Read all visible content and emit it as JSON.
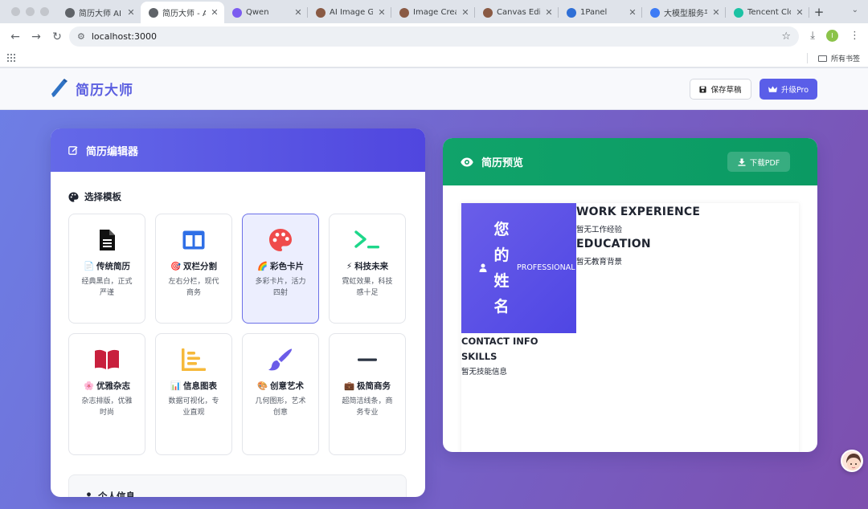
{
  "browser": {
    "tabs": [
      {
        "title": "简历大师 AI -",
        "active": false,
        "favicon": "globe-icon"
      },
      {
        "title": "简历大师 - AI",
        "active": true,
        "favicon": "globe-icon"
      },
      {
        "title": "Qwen",
        "active": false,
        "favicon": "qwen-icon"
      },
      {
        "title": "AI Image Gen",
        "active": false,
        "favicon": "image-icon"
      },
      {
        "title": "Image Creati",
        "active": false,
        "favicon": "image-icon"
      },
      {
        "title": "Canvas Edito",
        "active": false,
        "favicon": "image-icon"
      },
      {
        "title": "1Panel",
        "active": false,
        "favicon": "panel-icon"
      },
      {
        "title": "大模型服务平",
        "active": false,
        "favicon": "model-icon"
      },
      {
        "title": "Tencent Clou",
        "active": false,
        "favicon": "cloud-icon"
      }
    ],
    "url": "localhost:3000",
    "bookmarks_all": "所有书签",
    "profile_initial": "I"
  },
  "app": {
    "brand_name": "简历大师",
    "save_draft": "保存草稿",
    "upgrade_pro": "升级Pro"
  },
  "editor": {
    "title": "简历编辑器",
    "template_section": "选择模板",
    "templates": [
      {
        "emoji": "📄",
        "name": "传统简历",
        "desc": "经典黑白，正式严谨",
        "icon": "document-icon",
        "selected": false
      },
      {
        "emoji": "🎯",
        "name": "双栏分割",
        "desc": "左右分栏，现代商务",
        "icon": "columns-icon",
        "selected": false
      },
      {
        "emoji": "🌈",
        "name": "彩色卡片",
        "desc": "多彩卡片，活力四射",
        "icon": "palette-icon",
        "selected": true
      },
      {
        "emoji": "⚡",
        "name": "科技未来",
        "desc": "霓虹效果，科技感十足",
        "icon": "terminal-icon",
        "selected": false
      },
      {
        "emoji": "🌸",
        "name": "优雅杂志",
        "desc": "杂志排版，优雅时尚",
        "icon": "book-icon",
        "selected": false
      },
      {
        "emoji": "📊",
        "name": "信息图表",
        "desc": "数据可视化，专业直观",
        "icon": "chart-icon",
        "selected": false
      },
      {
        "emoji": "🎨",
        "name": "创意艺术",
        "desc": "几何图形，艺术创意",
        "icon": "brush-icon",
        "selected": false
      },
      {
        "emoji": "💼",
        "name": "极简商务",
        "desc": "超简洁线条，商务专业",
        "icon": "minus-icon",
        "selected": false
      }
    ],
    "personal_section": "个人信息"
  },
  "preview": {
    "title": "简历预览",
    "download_pdf": "下载PDF",
    "name_placeholder": "您的姓名",
    "professional": "PROFESSIONAL",
    "work_heading": "WORK EXPERIENCE",
    "work_empty": "暂无工作经验",
    "edu_heading": "EDUCATION",
    "edu_empty": "暂无教育背景",
    "contact_heading": "CONTACT INFO",
    "skills_heading": "SKILLS",
    "skills_empty": "暂无技能信息"
  },
  "colors": {
    "accent": "#5a5ee8",
    "preview_header": "#10a36a",
    "background_from": "#6d7fe6",
    "background_to": "#7d4fae"
  }
}
